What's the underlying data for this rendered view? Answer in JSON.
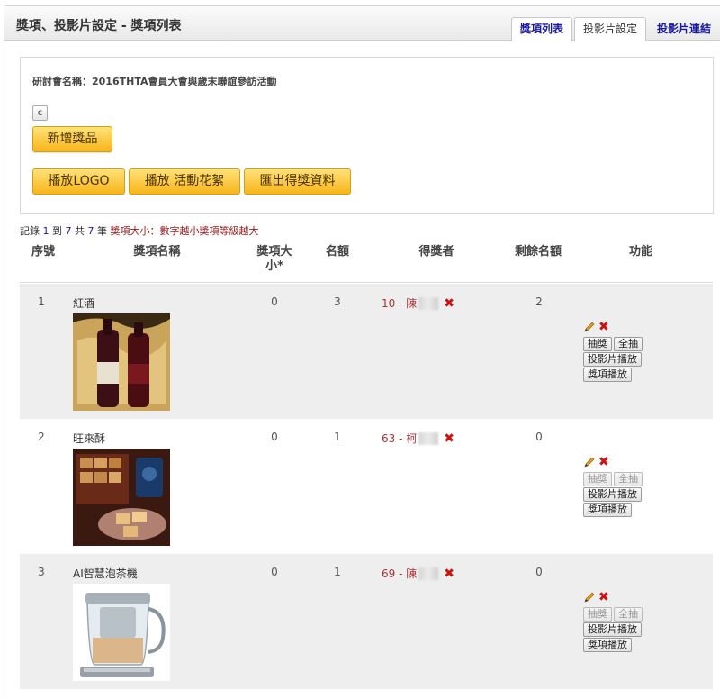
{
  "header": {
    "title": "獎項、投影片設定 - 獎項列表",
    "tabs": [
      {
        "label": "獎項列表"
      },
      {
        "label": "投影片設定"
      },
      {
        "label": "投影片連結"
      }
    ]
  },
  "panel": {
    "event_name": "研討會名稱：2016THTA會員大會與歲末聯誼參訪活動",
    "mini_button": "c",
    "add_prize": "新增獎品",
    "play_logo": "播放LOGO",
    "play_highlights": "播放 活動花絮",
    "export_winners": "匯出得獎資料"
  },
  "records": {
    "prefix": "記錄",
    "from": "1",
    "to_word": "到",
    "to": "7",
    "total_word": "共",
    "total": "7",
    "unit": "筆",
    "note": "獎項大小：數字越小獎項等級越大"
  },
  "table": {
    "headers": {
      "seq": "序號",
      "name": "獎項名稱",
      "size_line1": "獎項大",
      "size_line2": "小*",
      "quota": "名額",
      "winner": "得獎者",
      "remaining": "剩餘名額",
      "function": "功能"
    },
    "rows": [
      {
        "seq": "1",
        "name": "紅酒",
        "size": "0",
        "quota": "3",
        "winner": "10 - 陳",
        "remaining": "2",
        "draw_disabled": false
      },
      {
        "seq": "2",
        "name": "旺來酥",
        "size": "0",
        "quota": "1",
        "winner": "63 - 柯",
        "remaining": "0",
        "draw_disabled": true
      },
      {
        "seq": "3",
        "name": "AI智慧泡茶機",
        "size": "0",
        "quota": "1",
        "winner": "69 - 陳",
        "remaining": "0",
        "draw_disabled": true
      }
    ]
  },
  "actions": {
    "draw": "抽獎",
    "draw_all": "全抽",
    "slideshow": "投影片播放",
    "prize_play": "獎項播放"
  },
  "colors": {
    "accent_link": "#1a1aa0",
    "note_red": "#a01818",
    "button_yellow": "#f7b51a",
    "delete_red": "#cc1111"
  }
}
